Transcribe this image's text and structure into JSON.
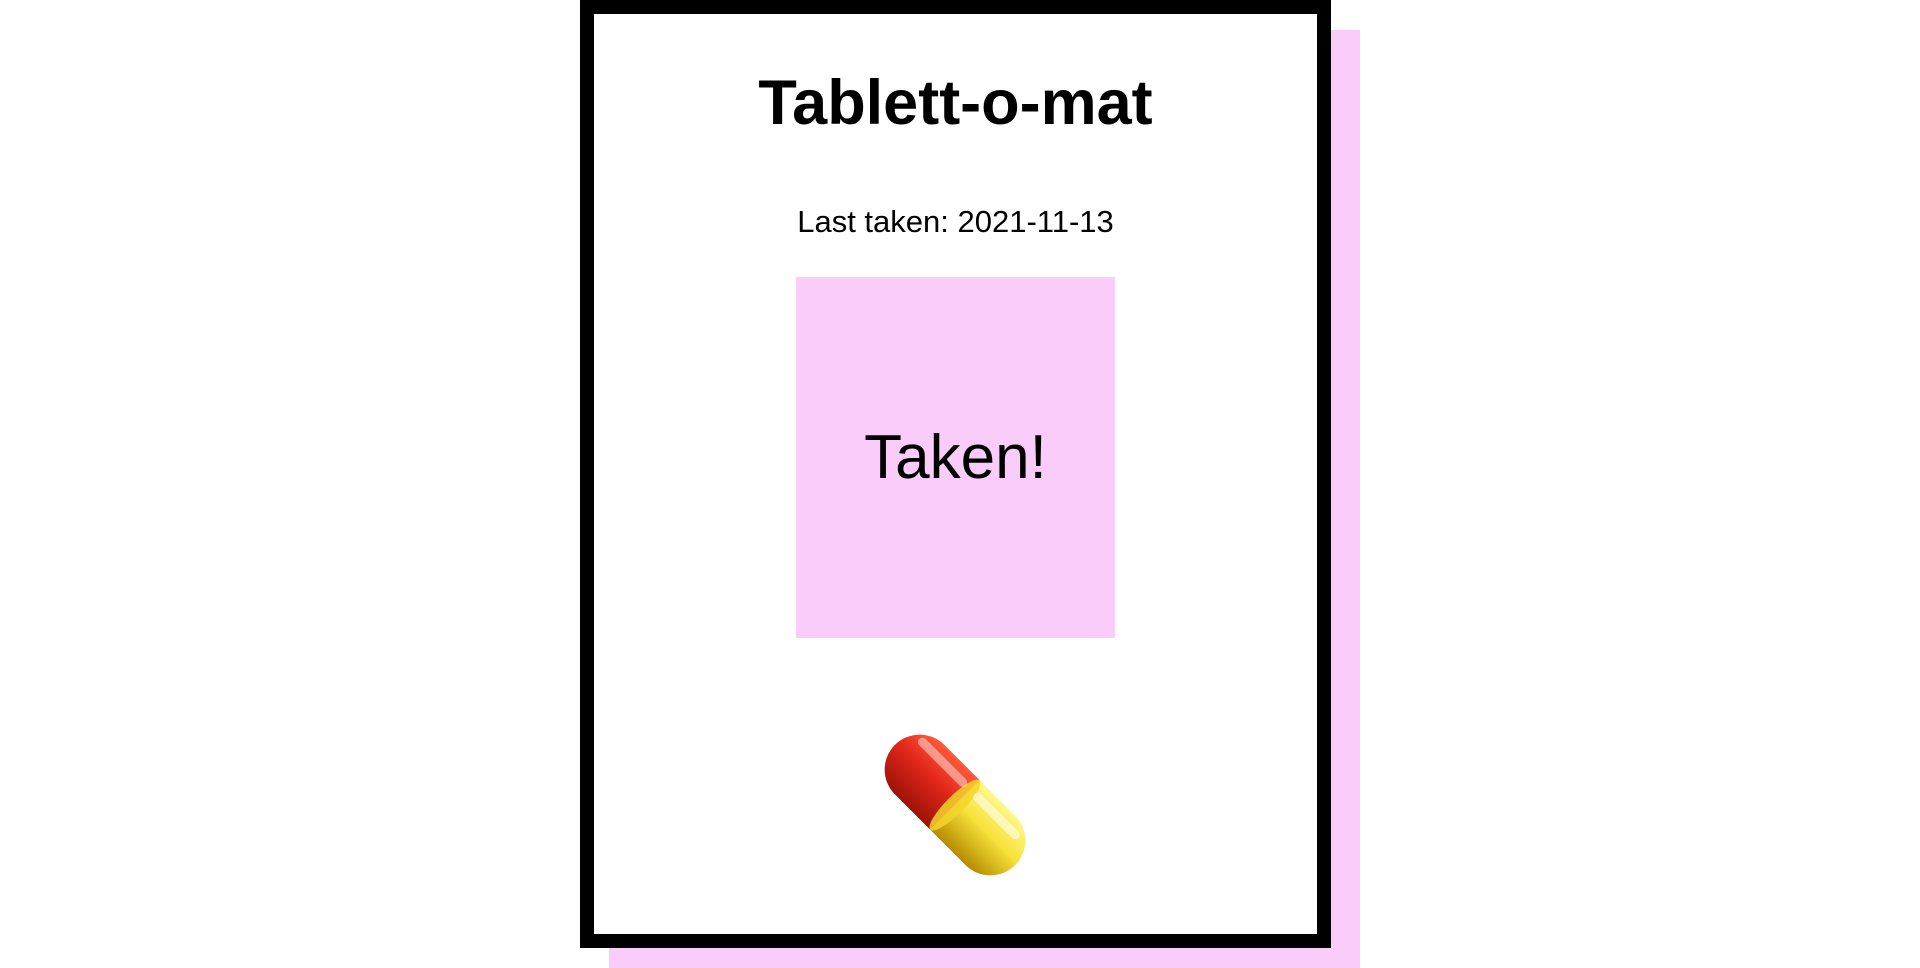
{
  "app": {
    "title": "Tablett-o-mat"
  },
  "status": {
    "last_taken_text": "Last taken: 2021-11-13"
  },
  "actions": {
    "taken_label": "Taken!"
  },
  "decoration": {
    "pill_icon": "pill-icon"
  },
  "colors": {
    "accent": "#f9ccf9",
    "border": "#000000",
    "pill_red": "#e2261b",
    "pill_yellow": "#f7e13a"
  }
}
